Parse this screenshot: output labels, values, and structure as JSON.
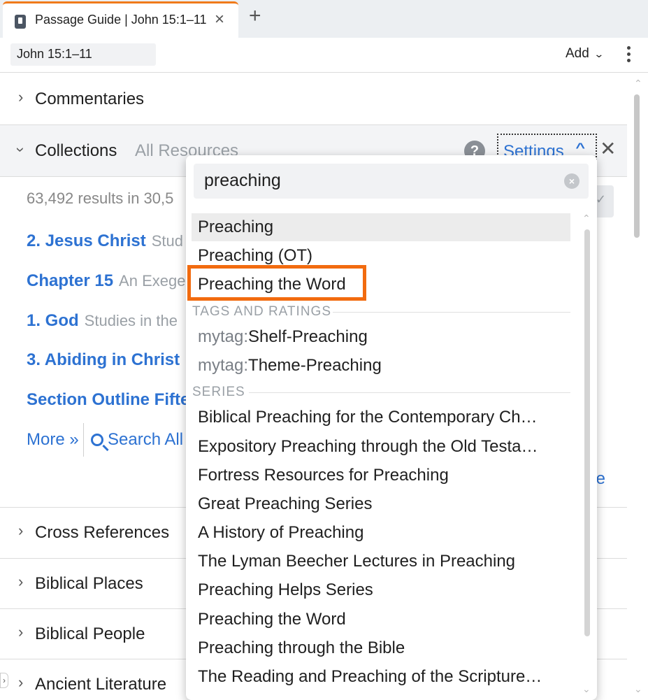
{
  "tab": {
    "title": "Passage Guide | John 15:1–11",
    "close": "×",
    "add": "+"
  },
  "toolbar": {
    "reference": "John 15:1–11",
    "add_label": "Add",
    "add_chevron": "⌄"
  },
  "sections": {
    "commentaries": "Commentaries",
    "collections": "Collections",
    "collections_sub": "All Resources",
    "settings_label": "Settings",
    "help": "?",
    "close": "✕",
    "cross_references": "Cross References",
    "biblical_places": "Biblical Places",
    "biblical_people": "Biblical People",
    "ancient_literature": "Ancient Literature"
  },
  "collections_body": {
    "results": "63,492 results in 30,5",
    "links": [
      {
        "title": "2. Jesus Christ",
        "sub": "Stud"
      },
      {
        "title": "Chapter 15",
        "sub": "An Exege"
      },
      {
        "title": "1. God",
        "sub": "Studies in the"
      },
      {
        "title": "3. Abiding in Christ",
        "sub": ""
      },
      {
        "title": "Section Outline Fifte",
        "sub": ""
      }
    ],
    "more": "More »",
    "search_all": "Search All",
    "tail": "te"
  },
  "dropdown": {
    "query": "preaching",
    "suggestions": [
      "Preaching",
      "Preaching (OT)",
      "Preaching the Word"
    ],
    "tags_header": "TAGS AND RATINGS",
    "tags": [
      {
        "prefix": "mytag:",
        "value": "Shelf-Preaching"
      },
      {
        "prefix": "mytag:",
        "value": "Theme-Preaching"
      }
    ],
    "series_header": "SERIES",
    "series": [
      "Biblical Preaching for the Contemporary Ch…",
      "Expository Preaching through the Old Testa…",
      "Fortress Resources for Preaching",
      "Great Preaching Series",
      "A History of Preaching",
      "The Lyman Beecher Lectures in Preaching",
      "Preaching Helps Series",
      "Preaching the Word",
      "Preaching through the Bible",
      "The Reading and Preaching of the Scripture…"
    ]
  }
}
